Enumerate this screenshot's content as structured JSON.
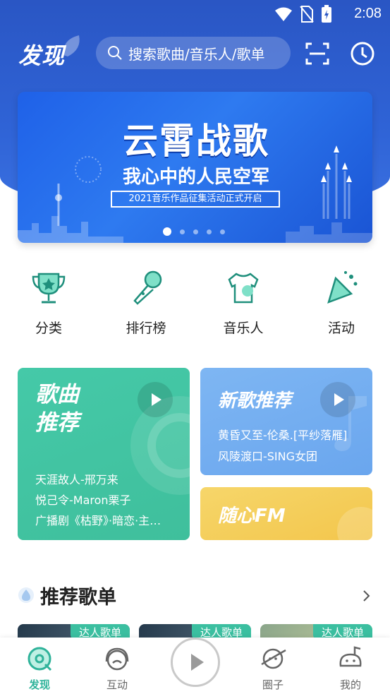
{
  "status_bar": {
    "time": "2:08",
    "icons": [
      "wifi-icon",
      "no-sim-icon",
      "battery-charging-icon"
    ]
  },
  "header": {
    "brand": "发现",
    "search": {
      "placeholder": "搜索歌曲/音乐人/歌单"
    },
    "icons": [
      "scan-icon",
      "history-clock-icon"
    ]
  },
  "banner": {
    "title": "云霄战歌",
    "subtitle": "我心中的人民空军",
    "tag": "2021音乐作品征集活动正式开启",
    "page_count": 5,
    "active_index": 0
  },
  "categories": [
    {
      "label": "分类",
      "icon": "trophy-icon"
    },
    {
      "label": "排行榜",
      "icon": "microphone-icon"
    },
    {
      "label": "音乐人",
      "icon": "tshirt-icon"
    },
    {
      "label": "活动",
      "icon": "party-popper-icon"
    }
  ],
  "cards": {
    "songs": {
      "title_line1": "歌曲",
      "title_line2": "推荐",
      "items": [
        "天涯故人-邢万来",
        "悦己令-Maron栗子",
        "广播剧《枯野》·暗恋·主…"
      ]
    },
    "new_songs": {
      "title": "新歌推荐",
      "items": [
        "黄昏又至-伦桑.[平纱落雁]",
        "风陵渡口-SING女团"
      ]
    },
    "fm": {
      "title": "随心FM"
    }
  },
  "section": {
    "title": "推荐歌单",
    "more_icon": "chevron-right-icon"
  },
  "playlists": [
    {
      "badge": "达人歌单"
    },
    {
      "badge": "达人歌单"
    },
    {
      "badge": "达人歌单"
    }
  ],
  "tabbar": {
    "tabs": [
      {
        "label": "发现",
        "active": true
      },
      {
        "label": "互动",
        "active": false
      },
      {
        "label": "圈子",
        "active": false
      },
      {
        "label": "我的",
        "active": false
      }
    ]
  },
  "colors": {
    "brand_blue": "#2f63d6",
    "accent_teal": "#2fb39a"
  }
}
